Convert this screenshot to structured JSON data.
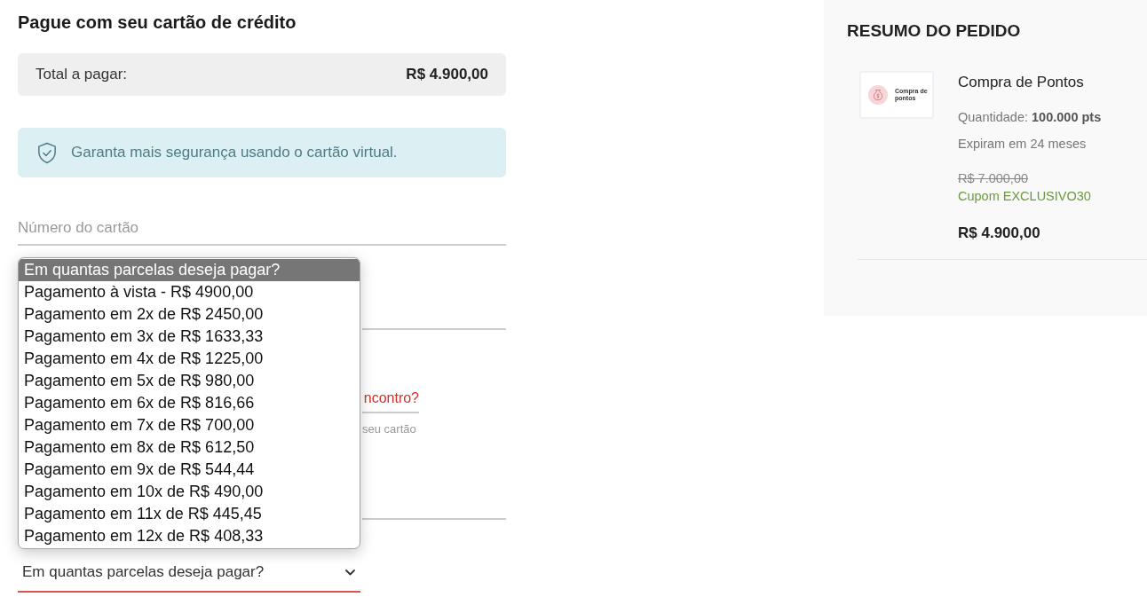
{
  "payment": {
    "title": "Pague com seu cartão de crédito",
    "total": {
      "label": "Total a pagar:",
      "value": "R$ 4.900,00"
    },
    "notice": "Garanta mais segurança usando o cartão virtual.",
    "card_number": {
      "placeholder": "Número do cartão"
    },
    "covered_fields": [
      {
        "kind": "line"
      },
      {
        "kind": "link",
        "link": "ncontro?",
        "hint": "seu cartão"
      },
      {
        "kind": "line"
      }
    ],
    "installments": {
      "value": "Em quantas parcelas deseja pagar?",
      "focused": true,
      "expanded": true,
      "options": [
        {
          "label": "Em quantas parcelas deseja pagar?",
          "selected": true
        },
        {
          "label": "Pagamento à vista - R$ 4900,00",
          "selected": false
        },
        {
          "label": "Pagamento em 2x de R$ 2450,00",
          "selected": false
        },
        {
          "label": "Pagamento em 3x de R$ 1633,33",
          "selected": false
        },
        {
          "label": "Pagamento em 4x de R$ 1225,00",
          "selected": false
        },
        {
          "label": "Pagamento em 5x de R$ 980,00",
          "selected": false
        },
        {
          "label": "Pagamento em 6x de R$ 816,66",
          "selected": false
        },
        {
          "label": "Pagamento em 7x de R$ 700,00",
          "selected": false
        },
        {
          "label": "Pagamento em 8x de R$ 612,50",
          "selected": false
        },
        {
          "label": "Pagamento em 9x de R$ 544,44",
          "selected": false
        },
        {
          "label": "Pagamento em 10x de R$ 490,00",
          "selected": false
        },
        {
          "label": "Pagamento em 11x de R$ 445,45",
          "selected": false
        },
        {
          "label": "Pagamento em 12x de R$ 408,33",
          "selected": false
        }
      ]
    }
  },
  "order_summary": {
    "title": "RESUMO DO PEDIDO",
    "items": [
      {
        "thumbnail_caption": "Compra de pontos",
        "name": "Compra de Pontos",
        "quantity": "Quantidade: **100.000 pts**",
        "expiry": "Expiram em 24 meses",
        "old_price": "R$ 7.000,00",
        "coupon": "Cupom EXCLUSIVO30",
        "price": "R$ 4.900,00"
      }
    ]
  }
}
